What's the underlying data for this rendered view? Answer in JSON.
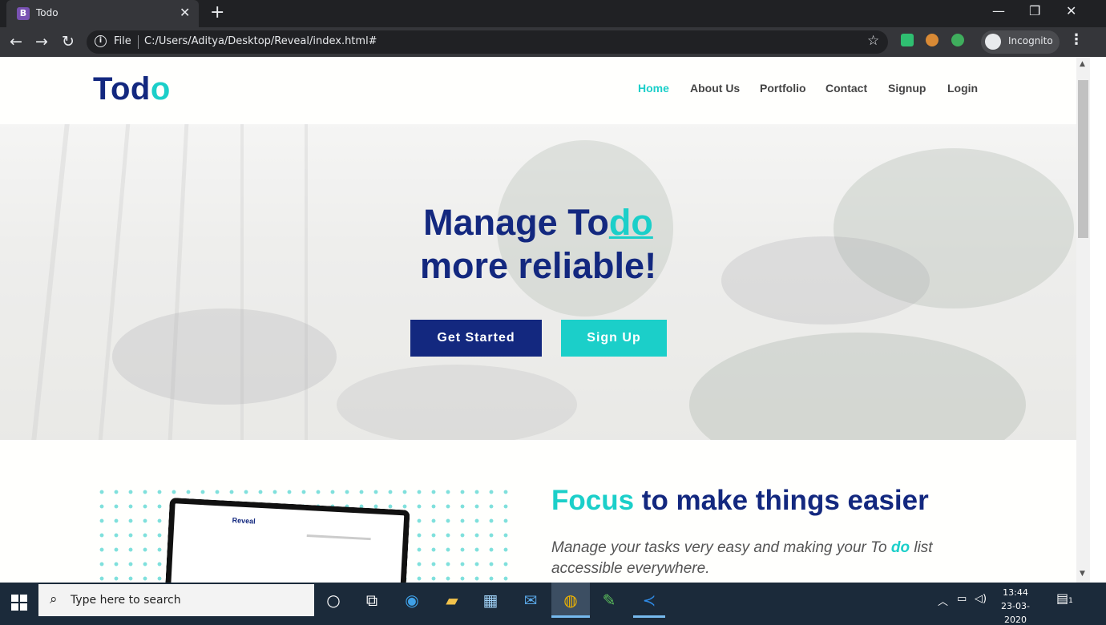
{
  "browser": {
    "tab_title": "Todo",
    "tab_favicon_letter": "B",
    "address_scheme": "File",
    "address_url": "C:/Users/Aditya/Desktop/Reveal/index.html#",
    "incognito_label": "Incognito"
  },
  "site": {
    "logo_main": "Tod",
    "logo_accent": "o",
    "nav": [
      {
        "label": "Home",
        "active": true
      },
      {
        "label": "About Us",
        "active": false
      },
      {
        "label": "Portfolio",
        "active": false
      },
      {
        "label": "Contact",
        "active": false
      },
      {
        "label": "Signup",
        "active": false
      },
      {
        "label": "Login",
        "active": false
      }
    ]
  },
  "hero": {
    "title_part1": "Manage To",
    "title_accent": "do",
    "title_line2": "more reliable!",
    "primary_button": "Get Started",
    "secondary_button": "Sign Up"
  },
  "feature": {
    "title_accent": "Focus",
    "title_rest": " to make things easier",
    "text_part1": "Manage your tasks very easy and making your To ",
    "text_accent": "do",
    "text_part2": " list accessible everywhere.",
    "laptop_logo": "Reveal"
  },
  "taskbar": {
    "search_placeholder": "Type here to search",
    "time": "13:44",
    "date": "23-03-2020",
    "notification_count": "1"
  },
  "colors": {
    "brand_navy": "#13287f",
    "brand_teal": "#1bcfc9",
    "chrome_dark": "#202124",
    "taskbar": "#1b2a3a"
  }
}
